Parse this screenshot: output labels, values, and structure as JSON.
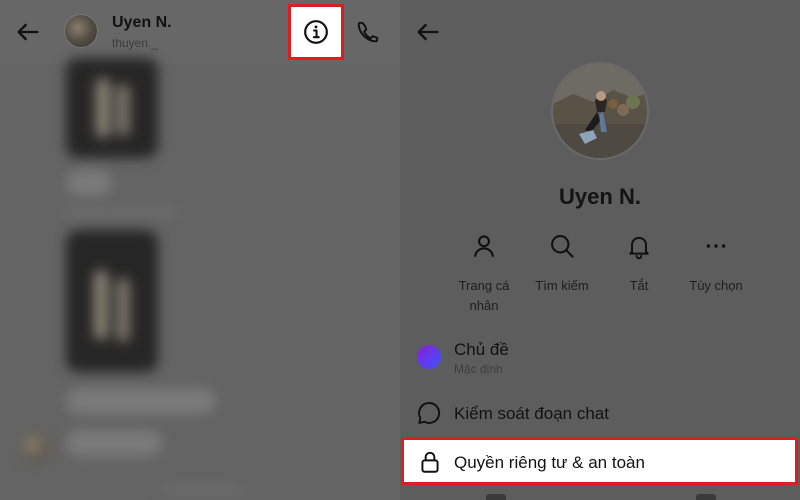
{
  "left_panel": {
    "header": {
      "name": "Uyen N.",
      "username": "thuyen._"
    }
  },
  "right_panel": {
    "profile": {
      "name": "Uyen N."
    },
    "actions": [
      {
        "label": "Trang cá nhân",
        "icon": "person-icon"
      },
      {
        "label": "Tìm kiếm",
        "icon": "search-icon"
      },
      {
        "label": "Tắt",
        "icon": "bell-icon"
      },
      {
        "label": "Tùy chọn",
        "icon": "more-icon"
      }
    ],
    "rows": {
      "theme": {
        "title": "Chủ đề",
        "subtitle": "Mặc định",
        "icon": "theme-dot-icon"
      },
      "chat_control": {
        "title": "Kiểm soát đoạn chat",
        "icon": "chat-bubble-icon"
      },
      "privacy": {
        "title": "Quyền riêng tư & an toàn",
        "icon": "lock-icon"
      }
    }
  },
  "colors": {
    "highlight_border": "#e01c1c",
    "overlay_bg": "#5e5e5e",
    "theme_gradient_start": "#8a1fd6",
    "theme_gradient_end": "#3c53ff"
  }
}
